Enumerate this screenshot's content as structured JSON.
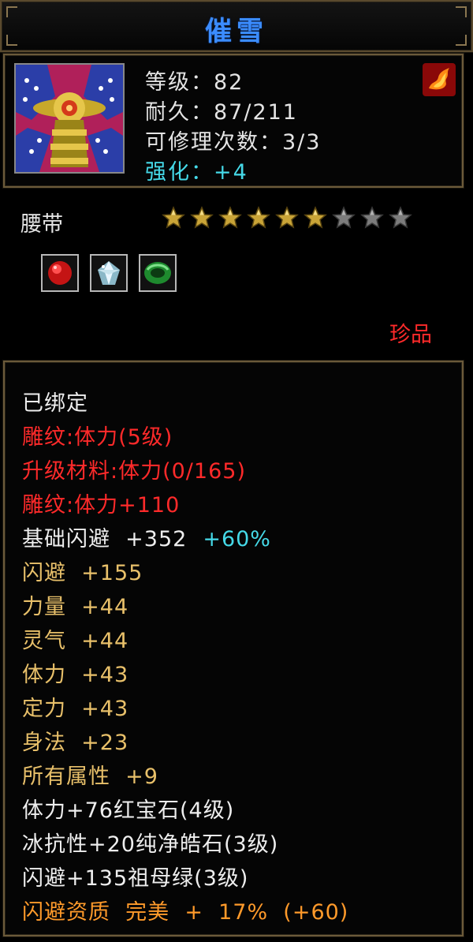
{
  "title": "催雪",
  "header": {
    "level": "等级：82",
    "durability": "耐久：87/211",
    "repair_count": "可修理次数：3/3",
    "enhance": "强化：+4"
  },
  "item_type": "腰带",
  "stars": {
    "filled": 6,
    "total": 9
  },
  "gems": [
    "ruby-gem-icon",
    "diamond-gem-icon",
    "emerald-gem-icon"
  ],
  "quality": "珍品",
  "attributes": {
    "bound": "已绑定",
    "engrave": "雕纹:体力(5级)",
    "upgrade_material": "升级材料:体力(0/165)",
    "engrave_bonus": "雕纹:体力+110",
    "base_dodge": "基础闪避  +352",
    "base_dodge_pct": "+60%",
    "dodge": "闪避  +155",
    "strength": "力量  +44",
    "spirit": "灵气  +44",
    "stamina": "体力  +43",
    "focus": "定力  +43",
    "agility": "身法  +23",
    "all_attributes": "所有属性  +9",
    "gem_ruby": "体力+76红宝石(4级)",
    "gem_diamond": "冰抗性+20纯净皓石(3级)",
    "gem_emerald": "闪避+135祖母绿(3级)",
    "dodge_aptitude": "闪避资质  完美  +  17%  (+60)"
  },
  "colors": {
    "title": "#3b8cff",
    "enhance": "#45d9e8",
    "red": "#ff2a2a",
    "gold": "#e8c06a",
    "orange": "#ff9a2a"
  }
}
